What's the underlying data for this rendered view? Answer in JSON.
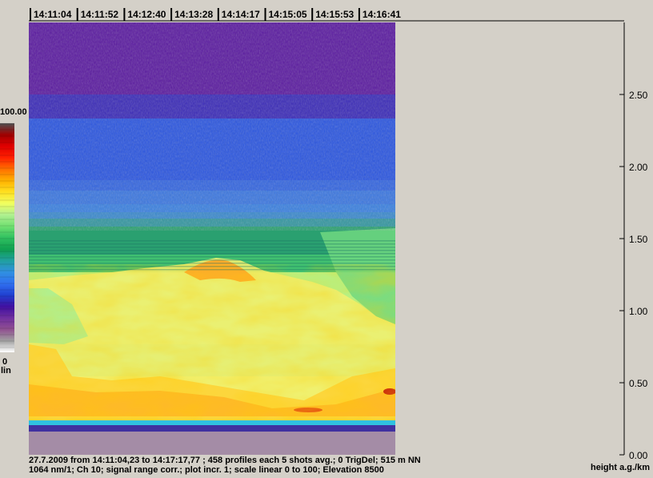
{
  "chart_data": {
    "type": "heatmap",
    "title": "",
    "time_ticks": [
      "14:11:04",
      "14:11:52",
      "14:12:40",
      "14:13:28",
      "14:14:17",
      "14:15:05",
      "14:15:53",
      "14:16:41"
    ],
    "y_ticks": [
      "0.00",
      "0.50",
      "1.00",
      "1.50",
      "2.00",
      "2.50"
    ],
    "y_values": [
      0.0,
      0.5,
      1.0,
      1.5,
      2.0,
      2.5
    ],
    "ylim": [
      0.0,
      2.85
    ],
    "ylabel": "height a.g./km",
    "colorbar": {
      "max_label": "100.00",
      "min_label": "0",
      "scale_label": "lin",
      "range": [
        0,
        100
      ]
    },
    "time_range": {
      "start": "14:11:04,23",
      "end": "14:17:17,77"
    },
    "grid": false
  },
  "footer": {
    "line1": "27.7.2009 from 14:11:04,23 to 14:17:17,77 ; 458 profiles  each 5 shots avg.; 0 TrigDel; 515 m NN",
    "line2": "1064 nm/1; Ch 10;  signal range corr.; plot incr. 1; scale linear 0 to 100; Elevation 8500"
  },
  "colors": {
    "background": "#d4d0c8",
    "ground": "#a48ca6",
    "colormap": [
      "#ffffff",
      "#a0a0a0",
      "#905090",
      "#7030a0",
      "#4010a0",
      "#2040d0",
      "#3070f0",
      "#3090e0",
      "#20a0a0",
      "#10a050",
      "#30c060",
      "#70e070",
      "#b0f090",
      "#f0ff60",
      "#ffe020",
      "#ffb000",
      "#ff7000",
      "#ff2000",
      "#e00000",
      "#a00000",
      "#505050"
    ]
  }
}
